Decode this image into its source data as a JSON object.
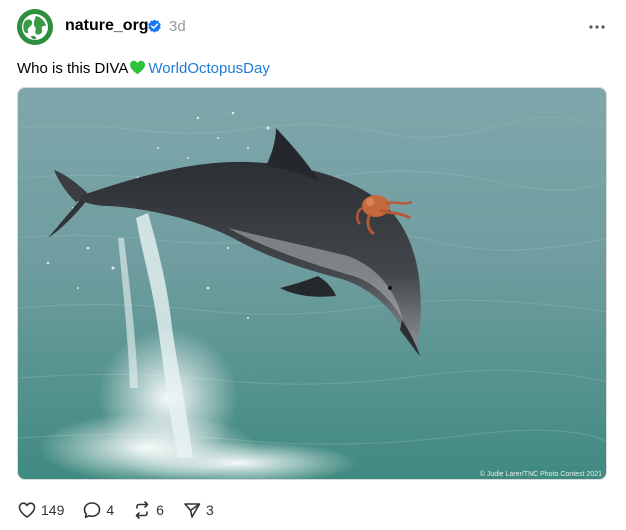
{
  "post": {
    "username": "nature_org",
    "timestamp": "3d",
    "caption_text": "Who is this DIVA",
    "caption_emoji": "green-heart",
    "hashtag": "WorldOctopusDay",
    "photo_credit": "© Judie Larer/TNC Photo Contest 2021",
    "verified": true
  },
  "actions": {
    "likes": "149",
    "replies": "4",
    "reposts": "6",
    "shares": "3"
  },
  "icons": {
    "avatar": "globe-leaf-icon",
    "verified": "verified-badge-icon",
    "more": "more-dots-icon",
    "like": "heart-icon",
    "reply": "comment-icon",
    "repost": "repost-icon",
    "share": "send-icon"
  },
  "colors": {
    "hashtag": "#1d7bd6",
    "verified": "#1877f2",
    "avatar": "#2e8f3e",
    "secondary_text": "#999999"
  }
}
